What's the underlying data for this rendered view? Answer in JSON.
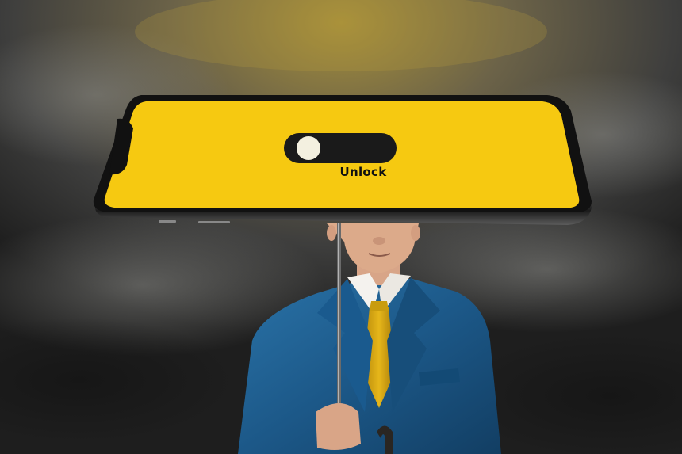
{
  "phone_screen": {
    "toggle": {
      "label": "Unlock",
      "state": "off",
      "track_color": "#1a1a1a",
      "knob_color": "#f3f0e0"
    },
    "screen_color": "#f6c911"
  },
  "scene": {
    "sky_colors": [
      "#2b2b2b",
      "#5a5a58",
      "#9a8a3c"
    ],
    "suit_color": "#1d5a8c",
    "tie_color": "#d9a90f"
  }
}
